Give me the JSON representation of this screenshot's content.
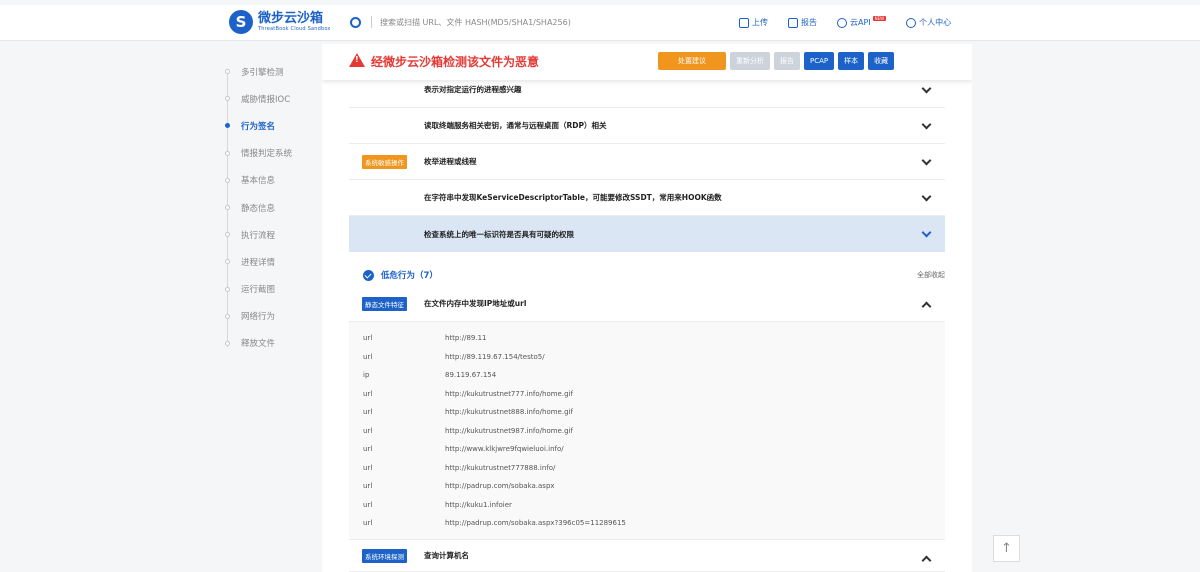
{
  "header": {
    "logo_text": "微步云沙箱",
    "logo_sub": "ThreatBook Cloud Sandbox",
    "search_placeholder": "搜索或扫描 URL、文件 HASH(MD5/SHA1/SHA256)",
    "nav": [
      {
        "label": "上传",
        "icon": "upload-icon"
      },
      {
        "label": "报告",
        "icon": "report-icon"
      },
      {
        "label": "云API",
        "icon": "cloud-api-icon",
        "badge": "NEW"
      },
      {
        "label": "个人中心",
        "icon": "user-icon"
      }
    ]
  },
  "sidebar": {
    "items": [
      {
        "label": "多引擎检测"
      },
      {
        "label": "威胁情报IOC"
      },
      {
        "label": "行为签名",
        "active": true
      },
      {
        "label": "情报判定系统"
      },
      {
        "label": "基本信息"
      },
      {
        "label": "静态信息"
      },
      {
        "label": "执行流程"
      },
      {
        "label": "进程详情"
      },
      {
        "label": "运行截图"
      },
      {
        "label": "网络行为"
      },
      {
        "label": "释放文件"
      }
    ]
  },
  "alert": {
    "text": "经微步云沙箱检测该文件为恶意",
    "buttons": {
      "handle": "处置建议",
      "reanalyze": "重新分析",
      "report": "报告",
      "pcap": "PCAP",
      "sample": "样本",
      "favorite": "收藏"
    }
  },
  "rows": [
    {
      "text": "表示对指定运行的进程感兴趣",
      "tag": ""
    },
    {
      "text": "读取终端服务相关密钥，通常与远程桌面（RDP）相关",
      "tag": ""
    },
    {
      "text": "枚举进程或线程",
      "tag": "系统敏感操作"
    },
    {
      "text": "在字符串中发现KeServiceDescriptorTable，可能要修改SSDT，常用来HOOK函数",
      "tag": ""
    },
    {
      "text": "检查系统上的唯一标识符是否具有可疑的权限",
      "tag": ""
    }
  ],
  "low_risk": {
    "title": "低危行为（7）",
    "collapse_all": "全部收起"
  },
  "ioc_row": {
    "tag": "静态文件特征",
    "text": "在文件内存中发现IP地址或url"
  },
  "ioc_items": [
    {
      "type": "url",
      "value": "http://89.11"
    },
    {
      "type": "url",
      "value": "http://89.119.67.154/testo5/"
    },
    {
      "type": "ip",
      "value": "89.119.67.154"
    },
    {
      "type": "url",
      "value": "http://kukutrustnet777.info/home.gif"
    },
    {
      "type": "url",
      "value": "http://kukutrustnet888.info/home.gif"
    },
    {
      "type": "url",
      "value": "http://kukutrustnet987.info/home.gif"
    },
    {
      "type": "url",
      "value": "http://www.klkjwre9fqwieluoi.info/"
    },
    {
      "type": "url",
      "value": "http://kukutrustnet777888.info/"
    },
    {
      "type": "url",
      "value": "http://padrup.com/sobaka.aspx"
    },
    {
      "type": "url",
      "value": "http://kuku1.infoier"
    },
    {
      "type": "url",
      "value": "http://padrup.com/sobaka.aspx?396c05=11289615"
    }
  ],
  "bottom_row": {
    "tag": "系统环境探测",
    "text": "查询计算机名"
  },
  "back_to_top": "↑",
  "colors": {
    "accent": "#1d62c8",
    "danger": "#e53935",
    "warning": "#f0961e"
  }
}
